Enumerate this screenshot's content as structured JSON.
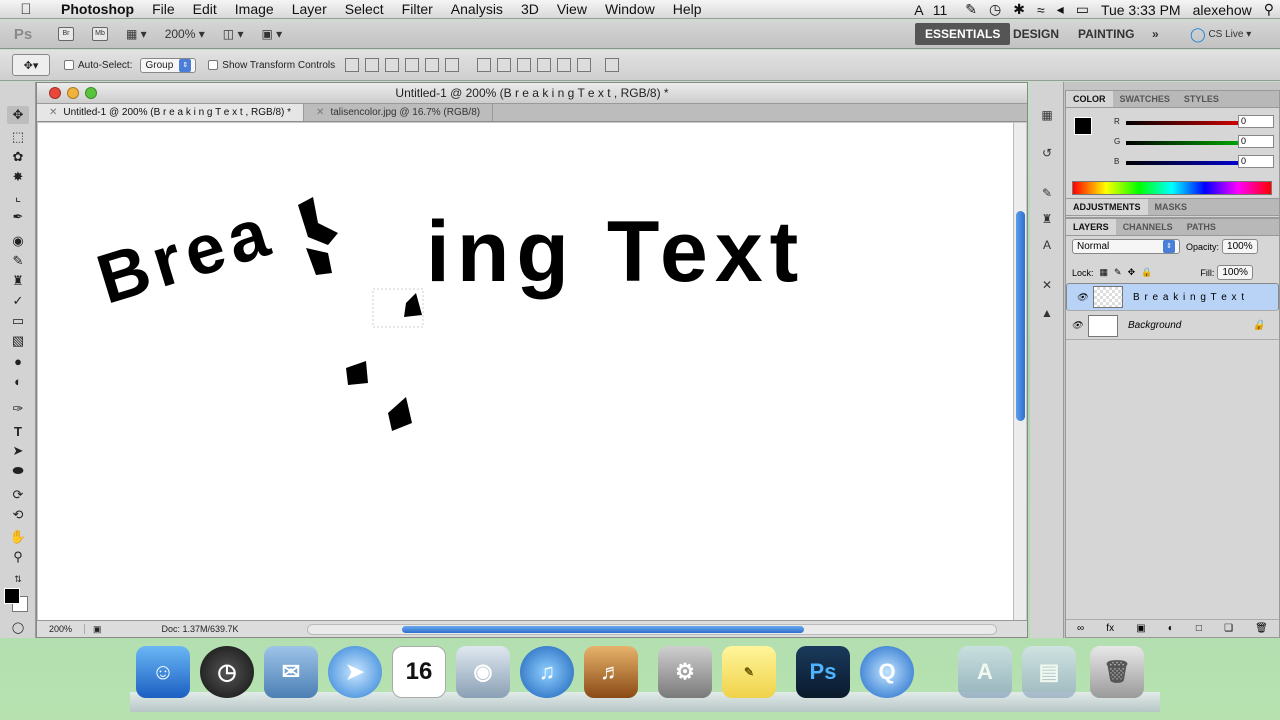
{
  "menubar": {
    "app": "Photoshop",
    "menus": [
      "File",
      "Edit",
      "Image",
      "Layer",
      "Select",
      "Filter",
      "Analysis",
      "3D",
      "View",
      "Window",
      "Help"
    ],
    "status": {
      "adobe_badge": "11",
      "clock": "Tue 3:33 PM",
      "user": "alexehow"
    }
  },
  "appbar": {
    "ps_logo": "Ps",
    "bridge_label": "Br",
    "minibridge_label": "Mb",
    "zoom": "200%",
    "workspaces": [
      "ESSENTIALS",
      "DESIGN",
      "PAINTING"
    ],
    "more": "»",
    "cslive": "CS Live"
  },
  "options": {
    "auto_select_label": "Auto-Select:",
    "auto_select_value": "Group",
    "transform_label": "Show Transform Controls"
  },
  "document": {
    "window_title": "Untitled-1 @ 200% (B r e a k i n g   T e x t , RGB/8) *",
    "tabs": [
      "Untitled-1 @ 200% (B r e a k i n g   T e x t , RGB/8) *",
      "talisencolor.jpg @ 16.7% (RGB/8)"
    ],
    "canvas_text": {
      "part1": "Brea",
      "part2": "ing Text"
    },
    "status_zoom": "200%",
    "status_doc": "Doc: 1.37M/639.7K"
  },
  "color_panel": {
    "tabs": [
      "COLOR",
      "SWATCHES",
      "STYLES"
    ],
    "r_label": "R",
    "g_label": "G",
    "b_label": "B",
    "r": "0",
    "g": "0",
    "b": "0"
  },
  "adjust_panel": {
    "tabs": [
      "ADJUSTMENTS",
      "MASKS"
    ]
  },
  "layers_panel": {
    "tabs": [
      "LAYERS",
      "CHANNELS",
      "PATHS"
    ],
    "blend": "Normal",
    "opacity_label": "Opacity:",
    "opacity": "100%",
    "lock_label": "Lock:",
    "fill_label": "Fill:",
    "fill": "100%",
    "layers": [
      {
        "name": "B r e a k i n g   T e x t",
        "selected": true
      },
      {
        "name": "Background",
        "selected": false
      }
    ]
  },
  "dock": {
    "calendar_day": "16",
    "ps_label": "Ps"
  }
}
